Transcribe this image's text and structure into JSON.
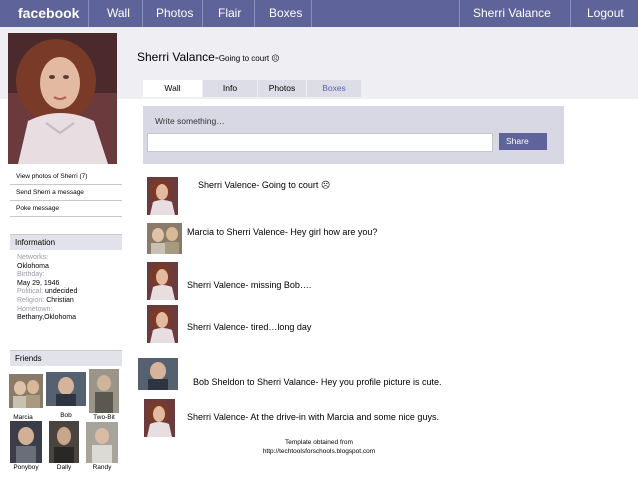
{
  "topbar": {
    "logo": "facebook",
    "nav": [
      "Wall",
      "Photos",
      "Flair",
      "Boxes"
    ],
    "user": "Sherri Valance",
    "logout": "Logout"
  },
  "profile": {
    "name": "Sherri Valance-",
    "status": "Going to court ☹"
  },
  "left_links": [
    "View photos of Sherri (7)",
    "Send Sherri a message",
    "Poke message"
  ],
  "information": {
    "header": "Information",
    "networks_label": "Networks:",
    "networks": "Oklohoma",
    "birthday_label": "Birthday:",
    "birthday": "May 29, 1946",
    "political_label": "Political:",
    "political": "undecided",
    "religion_label": "Religion:",
    "religion": "Christian",
    "hometown_label": "Hometown:",
    "hometown": "Bethany,Oklohoma"
  },
  "friends": {
    "header": "Friends",
    "names": [
      "Marcia",
      "Bob",
      "Two-Bit",
      "Ponyboy",
      "Dally",
      "Randy"
    ]
  },
  "tabs": [
    "Wall",
    "Info",
    "Photos",
    "Boxes"
  ],
  "composer": {
    "hint": "Write something…",
    "value": "",
    "share": "Share"
  },
  "posts": [
    "Sherri Valence- Going to court ☹",
    "Marcia to Sherri Valence- Hey girl how are you?",
    "Sherri Valence- missing Bob….",
    "Sherri Valence- tired…long day",
    "Bob Sheldon to Sherri Valance- Hey you profile picture is cute.",
    "Sherri Valence- At the drive-in with Marcia and some nice guys."
  ],
  "footer": {
    "line1": "Template obtained from",
    "line2": "http://techtoolsforschools.blogspot.com"
  },
  "colors": {
    "topbar": "#5e6399",
    "strip": "#eeeef3",
    "composer": "#d7d8e3",
    "tab_link": "#5c62b0"
  }
}
